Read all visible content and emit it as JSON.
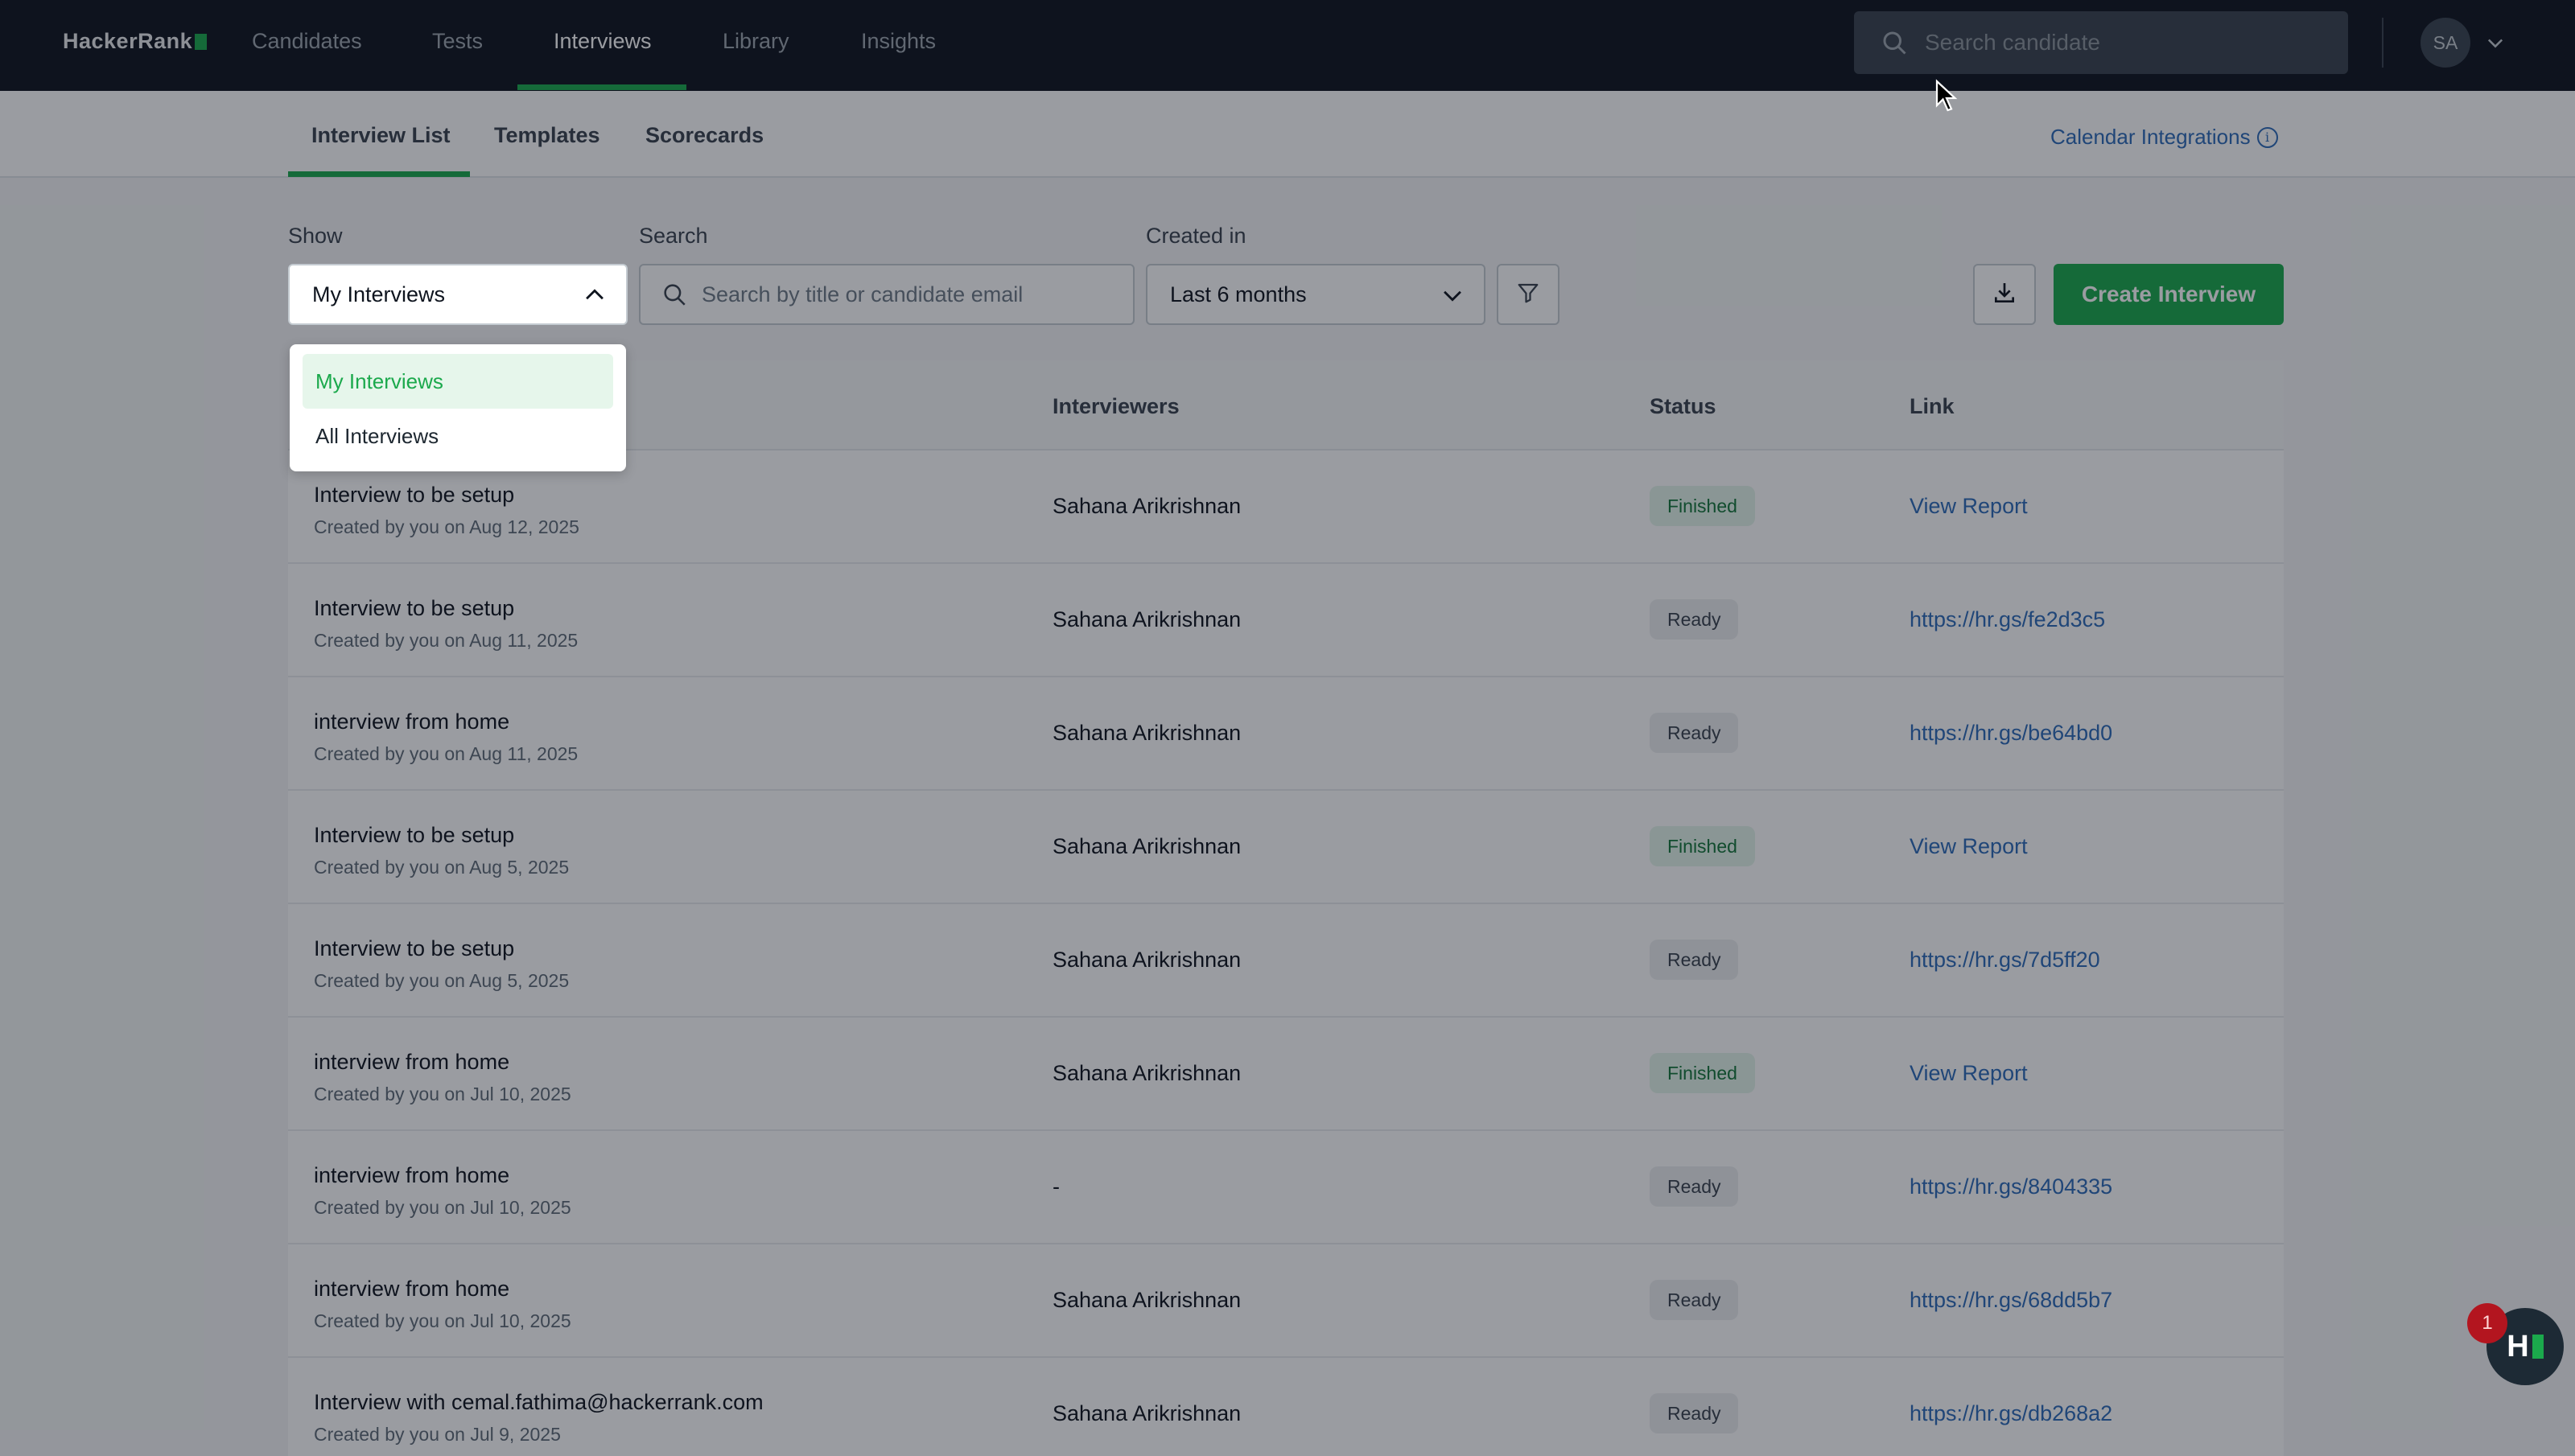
{
  "brand": {
    "name": "HackerRank"
  },
  "topnav": {
    "items": [
      {
        "label": "Candidates"
      },
      {
        "label": "Tests"
      },
      {
        "label": "Interviews"
      },
      {
        "label": "Library"
      },
      {
        "label": "Insights"
      }
    ],
    "active_item": "Interviews",
    "search_placeholder": "Search candidate",
    "avatar_initials": "SA"
  },
  "subtabs": {
    "items": [
      {
        "label": "Interview List"
      },
      {
        "label": "Templates"
      },
      {
        "label": "Scorecards"
      }
    ],
    "active_item": "Interview List",
    "calendar_link": "Calendar Integrations"
  },
  "filters": {
    "show_label": "Show",
    "show_value": "My Interviews",
    "search_label": "Search",
    "search_placeholder": "Search by title or candidate email",
    "created_label": "Created in",
    "created_value": "Last 6 months",
    "create_button": "Create Interview"
  },
  "show_dropdown": {
    "options": [
      {
        "label": "My Interviews",
        "selected": true
      },
      {
        "label": "All Interviews",
        "selected": false
      }
    ]
  },
  "table": {
    "columns": {
      "interviewers": "Interviewers",
      "status": "Status",
      "link": "Link"
    },
    "rows": [
      {
        "title": "Interview to be setup",
        "meta": "Created by you on Aug 12, 2025",
        "interviewers": "Sahana Arikrishnan",
        "status": "Finished",
        "link": "View Report"
      },
      {
        "title": "Interview to be setup",
        "meta": "Created by you on Aug 11, 2025",
        "interviewers": "Sahana Arikrishnan",
        "status": "Ready",
        "link": "https://hr.gs/fe2d3c5"
      },
      {
        "title": "interview from home",
        "meta": "Created by you on Aug 11, 2025",
        "interviewers": "Sahana Arikrishnan",
        "status": "Ready",
        "link": "https://hr.gs/be64bd0"
      },
      {
        "title": "Interview to be setup",
        "meta": "Created by you on Aug 5, 2025",
        "interviewers": "Sahana Arikrishnan",
        "status": "Finished",
        "link": "View Report"
      },
      {
        "title": "Interview to be setup",
        "meta": "Created by you on Aug 5, 2025",
        "interviewers": "Sahana Arikrishnan",
        "status": "Ready",
        "link": "https://hr.gs/7d5ff20"
      },
      {
        "title": "interview from home",
        "meta": "Created by you on Jul 10, 2025",
        "interviewers": "Sahana Arikrishnan",
        "status": "Finished",
        "link": "View Report"
      },
      {
        "title": "interview from home",
        "meta": "Created by you on Jul 10, 2025",
        "interviewers": "-",
        "status": "Ready",
        "link": "https://hr.gs/8404335"
      },
      {
        "title": "interview from home",
        "meta": "Created by you on Jul 10, 2025",
        "interviewers": "Sahana Arikrishnan",
        "status": "Ready",
        "link": "https://hr.gs/68dd5b7"
      },
      {
        "title": "Interview with cemal.fathima@hackerrank.com",
        "meta": "Created by you on Jul 9, 2025",
        "interviewers": "Sahana Arikrishnan",
        "status": "Ready",
        "link": "https://hr.gs/db268a2"
      }
    ]
  },
  "help_widget": {
    "notification_count": "1",
    "letter": "H"
  },
  "colors": {
    "accent": "#1ba94c",
    "nav_bg": "#0e141e",
    "link": "#2e6bb8"
  }
}
